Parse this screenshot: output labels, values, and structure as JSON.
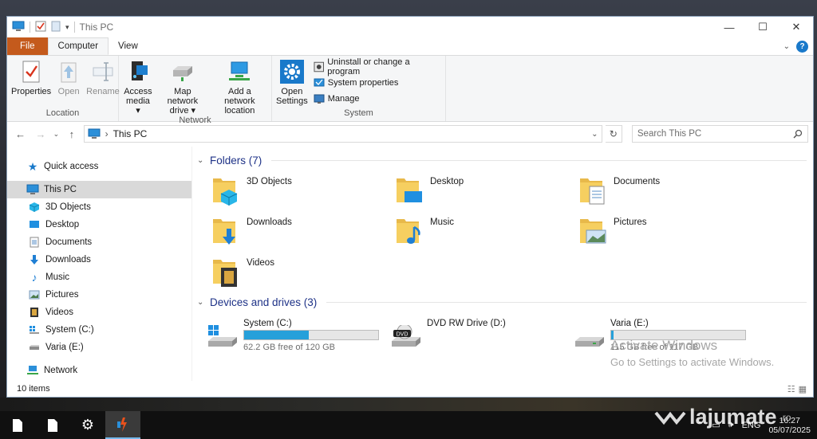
{
  "window": {
    "title": "This PC",
    "controls": {
      "minimize": "—",
      "maximize": "☐",
      "close": "✕"
    }
  },
  "ribbon": {
    "tabs": [
      {
        "label": "File"
      },
      {
        "label": "Computer"
      },
      {
        "label": "View"
      }
    ],
    "groups": {
      "location": {
        "label": "Location",
        "properties": "Properties",
        "open": "Open",
        "rename": "Rename"
      },
      "network": {
        "label": "Network",
        "access_media_1": "Access",
        "access_media_2": "media ▾",
        "map_drive_1": "Map network",
        "map_drive_2": "drive ▾",
        "add_location_1": "Add a network",
        "add_location_2": "location"
      },
      "system": {
        "label": "System",
        "open_settings_1": "Open",
        "open_settings_2": "Settings",
        "uninstall": "Uninstall or change a program",
        "system_properties": "System properties",
        "manage": "Manage"
      }
    }
  },
  "address": {
    "path": "This PC",
    "search_placeholder": "Search This PC"
  },
  "nav": {
    "quick_access": "Quick access",
    "this_pc": "This PC",
    "items": [
      {
        "label": "3D Objects",
        "icon": "cube-icon"
      },
      {
        "label": "Desktop",
        "icon": "desktop-icon"
      },
      {
        "label": "Documents",
        "icon": "document-icon"
      },
      {
        "label": "Downloads",
        "icon": "download-icon"
      },
      {
        "label": "Music",
        "icon": "music-icon"
      },
      {
        "label": "Pictures",
        "icon": "picture-icon"
      },
      {
        "label": "Videos",
        "icon": "video-icon"
      },
      {
        "label": "System (C:)",
        "icon": "windows-drive-icon"
      },
      {
        "label": "Varia (E:)",
        "icon": "drive-icon"
      }
    ],
    "network": "Network"
  },
  "folders": {
    "heading": "Folders (7)",
    "items": [
      {
        "label": "3D Objects"
      },
      {
        "label": "Desktop"
      },
      {
        "label": "Documents"
      },
      {
        "label": "Downloads"
      },
      {
        "label": "Music"
      },
      {
        "label": "Pictures"
      },
      {
        "label": "Videos"
      }
    ]
  },
  "drives": {
    "heading": "Devices and drives (3)",
    "items": [
      {
        "label": "System (C:)",
        "free": "62.2 GB free of 120 GB",
        "used_fraction": 0.48
      },
      {
        "label": "DVD RW Drive (D:)",
        "dvd_badge": "DVD"
      },
      {
        "label": "Varia (E:)",
        "free": "115 GB free of 117 GB",
        "used_fraction": 0.02
      }
    ]
  },
  "activation": {
    "title": "Activate Windows",
    "subtitle": "Go to Settings to activate Windows."
  },
  "status": {
    "item_count": "10 items"
  },
  "taskbar": {
    "clock_time": "16:27",
    "clock_date": "05/07/2025",
    "lang": "ENG"
  },
  "watermark": {
    "brand": "lajumate",
    "suffix": ".ro"
  },
  "colors": {
    "accent": "#1979ca",
    "file_tab": "#c45a1c",
    "drive_bar": "#26a0da",
    "section_heading": "#1e3287"
  }
}
